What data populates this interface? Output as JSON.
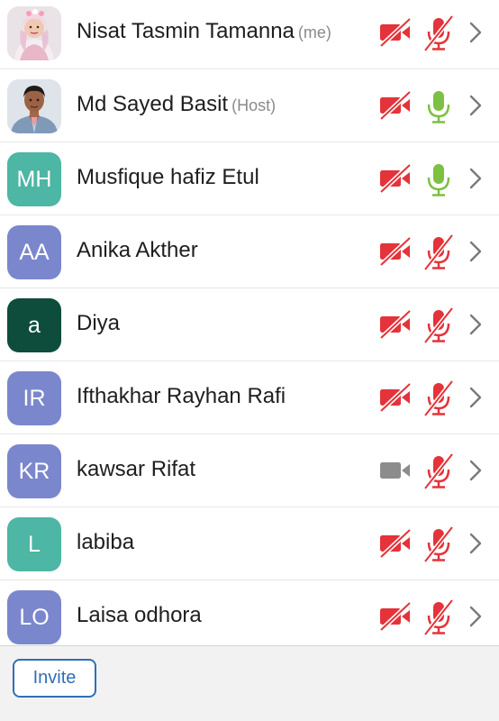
{
  "colors": {
    "muted_red": "#e4333a",
    "unmuted_green": "#7cc142",
    "camera_on_gray": "#8c8c8c",
    "accent_blue": "#2f6fb6"
  },
  "participants": [
    {
      "name": "Nisat Tasmin Tamanna",
      "tag": "(me)",
      "avatar_text": "",
      "avatar_type": "photo-girl",
      "avatar_color": "#e9dfe4",
      "video": "off",
      "audio": "muted"
    },
    {
      "name": "Md Sayed Basit",
      "tag": "(Host)",
      "avatar_text": "",
      "avatar_type": "photo-boy",
      "avatar_color": "#dde3ea",
      "video": "off",
      "audio": "unmuted"
    },
    {
      "name": "Musfique hafiz Etul",
      "tag": "",
      "avatar_text": "MH",
      "avatar_type": "initials",
      "avatar_color": "#4db6a4",
      "video": "off",
      "audio": "unmuted"
    },
    {
      "name": "Anika Akther",
      "tag": "",
      "avatar_text": "AA",
      "avatar_type": "initials",
      "avatar_color": "#7b87cc",
      "video": "off",
      "audio": "muted"
    },
    {
      "name": "Diya",
      "tag": "",
      "avatar_text": "a",
      "avatar_type": "initials",
      "avatar_color": "#0e4d3b",
      "video": "off",
      "audio": "muted"
    },
    {
      "name": "Ifthakhar Rayhan Rafi",
      "tag": "",
      "avatar_text": "IR",
      "avatar_type": "initials",
      "avatar_color": "#7b87cc",
      "video": "off",
      "audio": "muted"
    },
    {
      "name": "kawsar Rifat",
      "tag": "",
      "avatar_text": "KR",
      "avatar_type": "initials",
      "avatar_color": "#7b87cc",
      "video": "on",
      "audio": "muted"
    },
    {
      "name": "labiba",
      "tag": "",
      "avatar_text": "L",
      "avatar_type": "initials",
      "avatar_color": "#4db6a4",
      "video": "off",
      "audio": "muted"
    },
    {
      "name": "Laisa odhora",
      "tag": "",
      "avatar_text": "LO",
      "avatar_type": "initials",
      "avatar_color": "#7b87cc",
      "video": "off",
      "audio": "muted"
    }
  ],
  "footer": {
    "invite_label": "Invite"
  }
}
